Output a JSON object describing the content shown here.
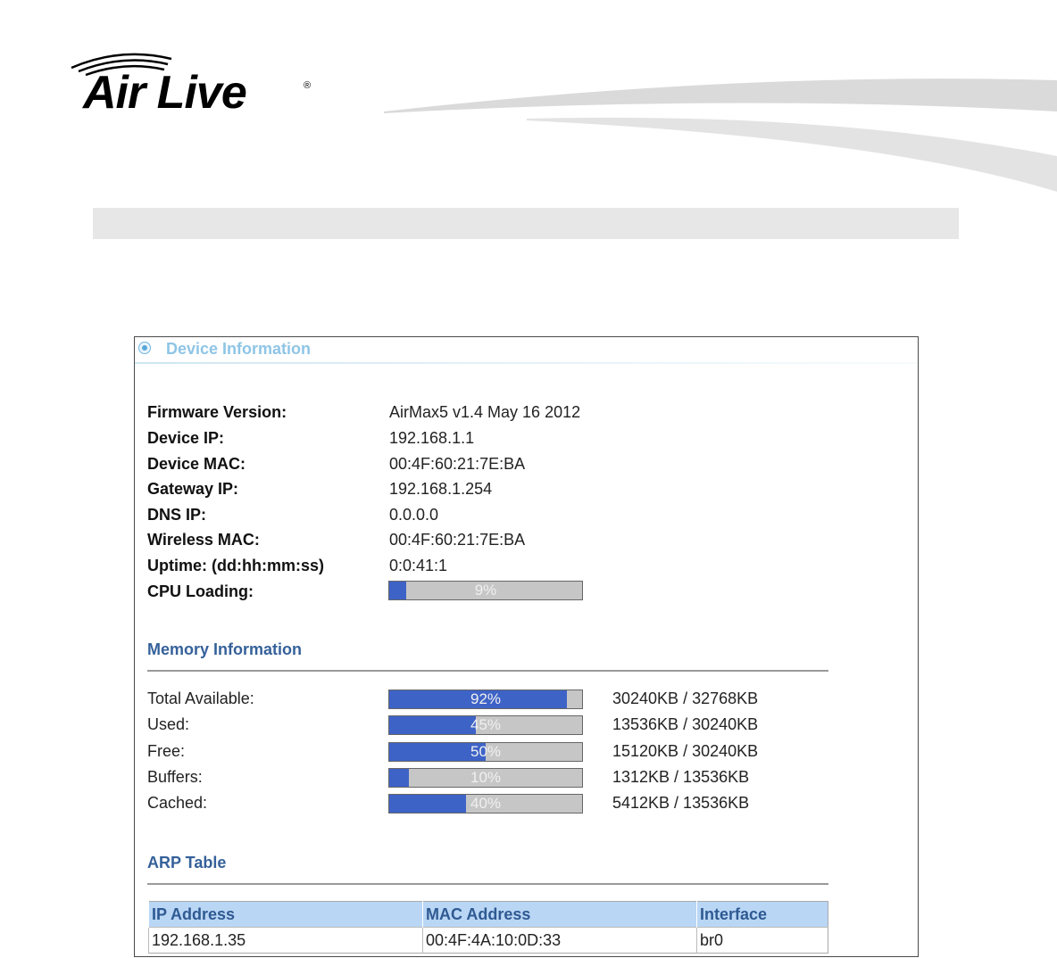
{
  "brand": {
    "name": "Air Live",
    "registered": "®"
  },
  "panel": {
    "title": "Device Information"
  },
  "device_info": [
    {
      "label": "Firmware Version:",
      "value": "AirMax5 v1.4 May 16 2012"
    },
    {
      "label": "Device IP:",
      "value": "192.168.1.1"
    },
    {
      "label": "Device MAC:",
      "value": "00:4F:60:21:7E:BA"
    },
    {
      "label": "Gateway IP:",
      "value": "192.168.1.254"
    },
    {
      "label": "DNS IP:",
      "value": "0.0.0.0"
    },
    {
      "label": "Wireless MAC:",
      "value": "00:4F:60:21:7E:BA"
    },
    {
      "label": "Uptime: (dd:hh:mm:ss)",
      "value": "0:0:41:1"
    }
  ],
  "cpu": {
    "label": "CPU Loading:",
    "percent_text": "9%",
    "percent": 9
  },
  "memory": {
    "title": "Memory Information",
    "rows": [
      {
        "label": "Total Available:",
        "percent_text": "92%",
        "percent": 92,
        "value": "30240KB / 32768KB"
      },
      {
        "label": "Used:",
        "percent_text": "45%",
        "percent": 45,
        "value": "13536KB / 30240KB"
      },
      {
        "label": "Free:",
        "percent_text": "50%",
        "percent": 50,
        "value": "15120KB / 30240KB"
      },
      {
        "label": "Buffers:",
        "percent_text": "10%",
        "percent": 10,
        "value": "1312KB / 13536KB"
      },
      {
        "label": "Cached:",
        "percent_text": "40%",
        "percent": 40,
        "value": "5412KB / 13536KB"
      }
    ]
  },
  "arp": {
    "title": "ARP Table",
    "columns": [
      "IP Address",
      "MAC Address",
      "Interface"
    ],
    "rows": [
      [
        "192.168.1.35",
        "00:4F:4A:10:0D:33",
        "br0"
      ]
    ]
  },
  "colors": {
    "bar_fill": "#3e63c7",
    "bar_track": "#c6c6c6",
    "section_title": "#35619a",
    "panel_title": "#8ec5e6"
  }
}
